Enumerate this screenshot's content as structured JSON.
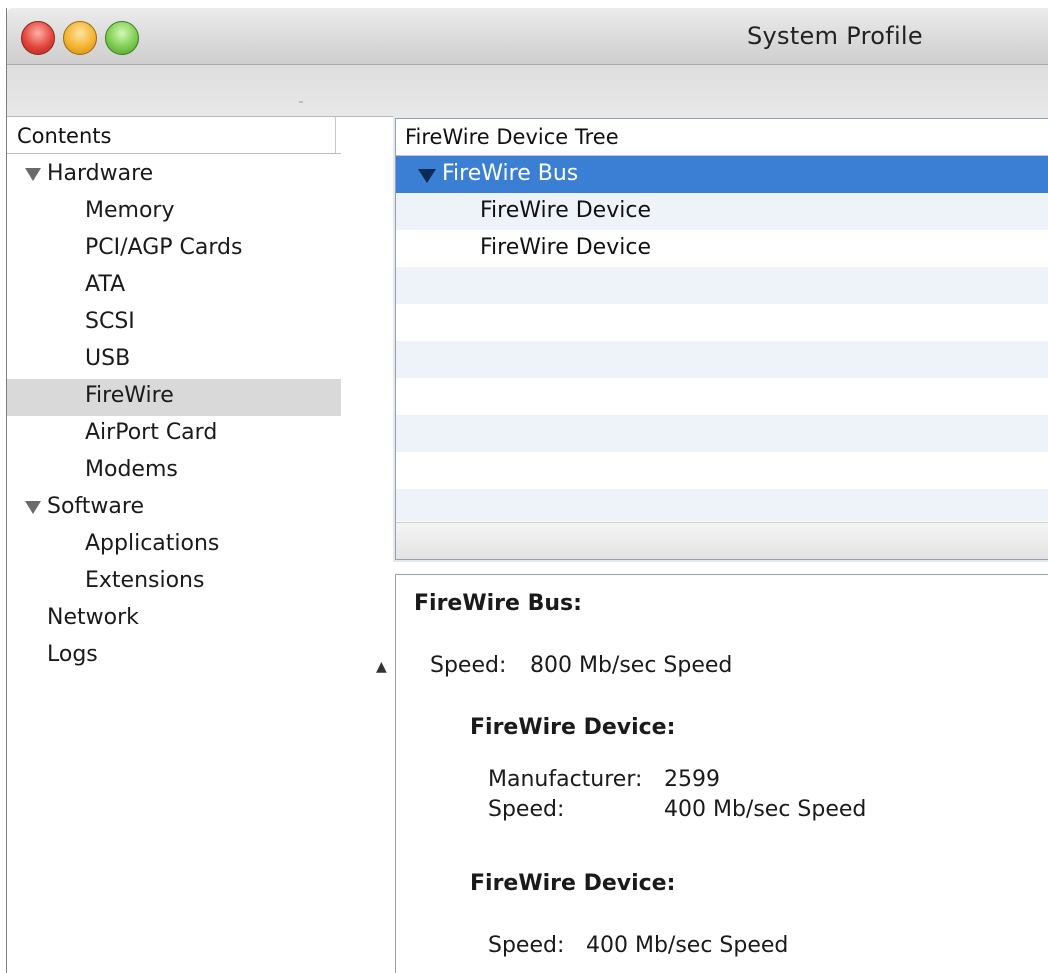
{
  "window": {
    "title": "System Profile",
    "buttons": [
      "close",
      "minimize",
      "zoom"
    ]
  },
  "sidebar": {
    "header": "Contents",
    "items": [
      {
        "label": "Hardware",
        "expanded": true
      },
      {
        "label": "Memory"
      },
      {
        "label": "PCI/AGP Cards"
      },
      {
        "label": "ATA"
      },
      {
        "label": "SCSI"
      },
      {
        "label": "USB"
      },
      {
        "label": "FireWire",
        "selected": true
      },
      {
        "label": "AirPort Card"
      },
      {
        "label": "Modems"
      },
      {
        "label": "Software",
        "expanded": true
      },
      {
        "label": "Applications"
      },
      {
        "label": "Extensions"
      },
      {
        "label": "Network"
      },
      {
        "label": "Logs"
      }
    ]
  },
  "device_tree": {
    "header": "FireWire Device Tree",
    "rows": [
      {
        "label": "FireWire Bus",
        "selected": true
      },
      {
        "label": "FireWire Device"
      },
      {
        "label": "FireWire Device"
      }
    ]
  },
  "details": {
    "bus_title": "FireWire Bus:",
    "bus_speed_label": "Speed:",
    "bus_speed_value": "800 Mb/sec Speed",
    "device1_title": "FireWire Device:",
    "device1_manufacturer_label": "Manufacturer:",
    "device1_manufacturer_value": "2599",
    "device1_speed_label": "Speed:",
    "device1_speed_value": "400 Mb/sec Speed",
    "device2_title": "FireWire Device:",
    "device2_speed_label": "Speed:",
    "device2_speed_value": "400 Mb/sec Speed"
  },
  "colors": {
    "selection_blue": "#3a7fd4",
    "sidebar_selection": "#d9d9d9",
    "stripe": "#eef3fa"
  }
}
